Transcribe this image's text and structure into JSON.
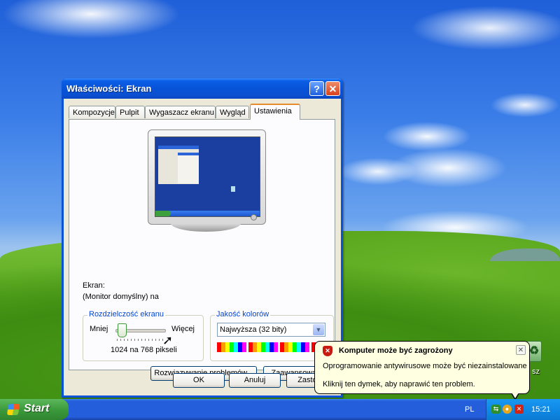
{
  "window": {
    "title": "Właściwości: Ekran",
    "help_glyph": "?",
    "close_glyph": "✕"
  },
  "tabs": [
    {
      "label": "Kompozycje"
    },
    {
      "label": "Pulpit"
    },
    {
      "label": "Wygaszacz ekranu"
    },
    {
      "label": "Wygląd"
    },
    {
      "label": "Ustawienia",
      "active": true
    }
  ],
  "settings": {
    "display_label": "Ekran:",
    "monitor_name": "(Monitor domyślny) na",
    "resolution": {
      "group_title": "Rozdzielczość ekranu",
      "less": "Mniej",
      "more": "Więcej",
      "value_text": "1024 na 768 pikseli",
      "slider_position": 0.1
    },
    "color_quality": {
      "group_title": "Jakość kolorów",
      "selected": "Najwyższa (32 bity)"
    },
    "troubleshoot_button": "Rozwiązywanie problemów...",
    "advanced_button": "Zaawansowane"
  },
  "dialog_buttons": {
    "ok": "OK",
    "cancel": "Anuluj",
    "apply": "Zastosuj"
  },
  "balloon": {
    "title": "Komputer może być zagrożony",
    "message": "Oprogramowanie antywirusowe może być niezainstalowane",
    "action": "Kliknij ten dymek, aby naprawić ten problem.",
    "icon": "security-shield-icon",
    "close_glyph": "✕"
  },
  "desktop": {
    "recycle_bin_label_fragment": "sz"
  },
  "taskbar": {
    "start_label": "Start",
    "language": "PL",
    "clock": "15:21"
  },
  "colors": {
    "titlebar": "#0753d8",
    "dialog_bg": "#ece9d8",
    "group_title": "#0046d5",
    "balloon_bg": "#ffffe1",
    "taskbar": "#245edb",
    "start_button": "#3c9b3c"
  }
}
